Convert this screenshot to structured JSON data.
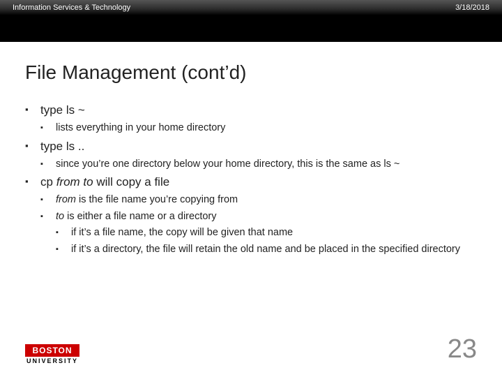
{
  "header": {
    "left": "Information Services & Technology",
    "right": "3/18/2018"
  },
  "title": "File Management (cont’d)",
  "b1": {
    "prefix": "type ",
    "cmd": "ls ~",
    "sub1": "lists everything in your home directory"
  },
  "b2": {
    "prefix": "type ",
    "cmd": "ls ..",
    "sub1_a": "since you’re one directory below your home directory, this is the same as ",
    "sub1_b": "ls ~"
  },
  "b3": {
    "p1": "cp ",
    "p2": "from to",
    "p3": " will copy a file",
    "s1_a": "from",
    "s1_b": " is the file name you’re copying from",
    "s2_a": "to",
    "s2_b": " is either a file name or a directory",
    "s2_i": "if it’s a file name, the copy will be given that name",
    "s2_ii": "if it’s a directory, the file will retain the old name and be placed in the specified directory"
  },
  "logo": {
    "top": "BOSTON",
    "bottom": "UNIVERSITY"
  },
  "page": "23"
}
